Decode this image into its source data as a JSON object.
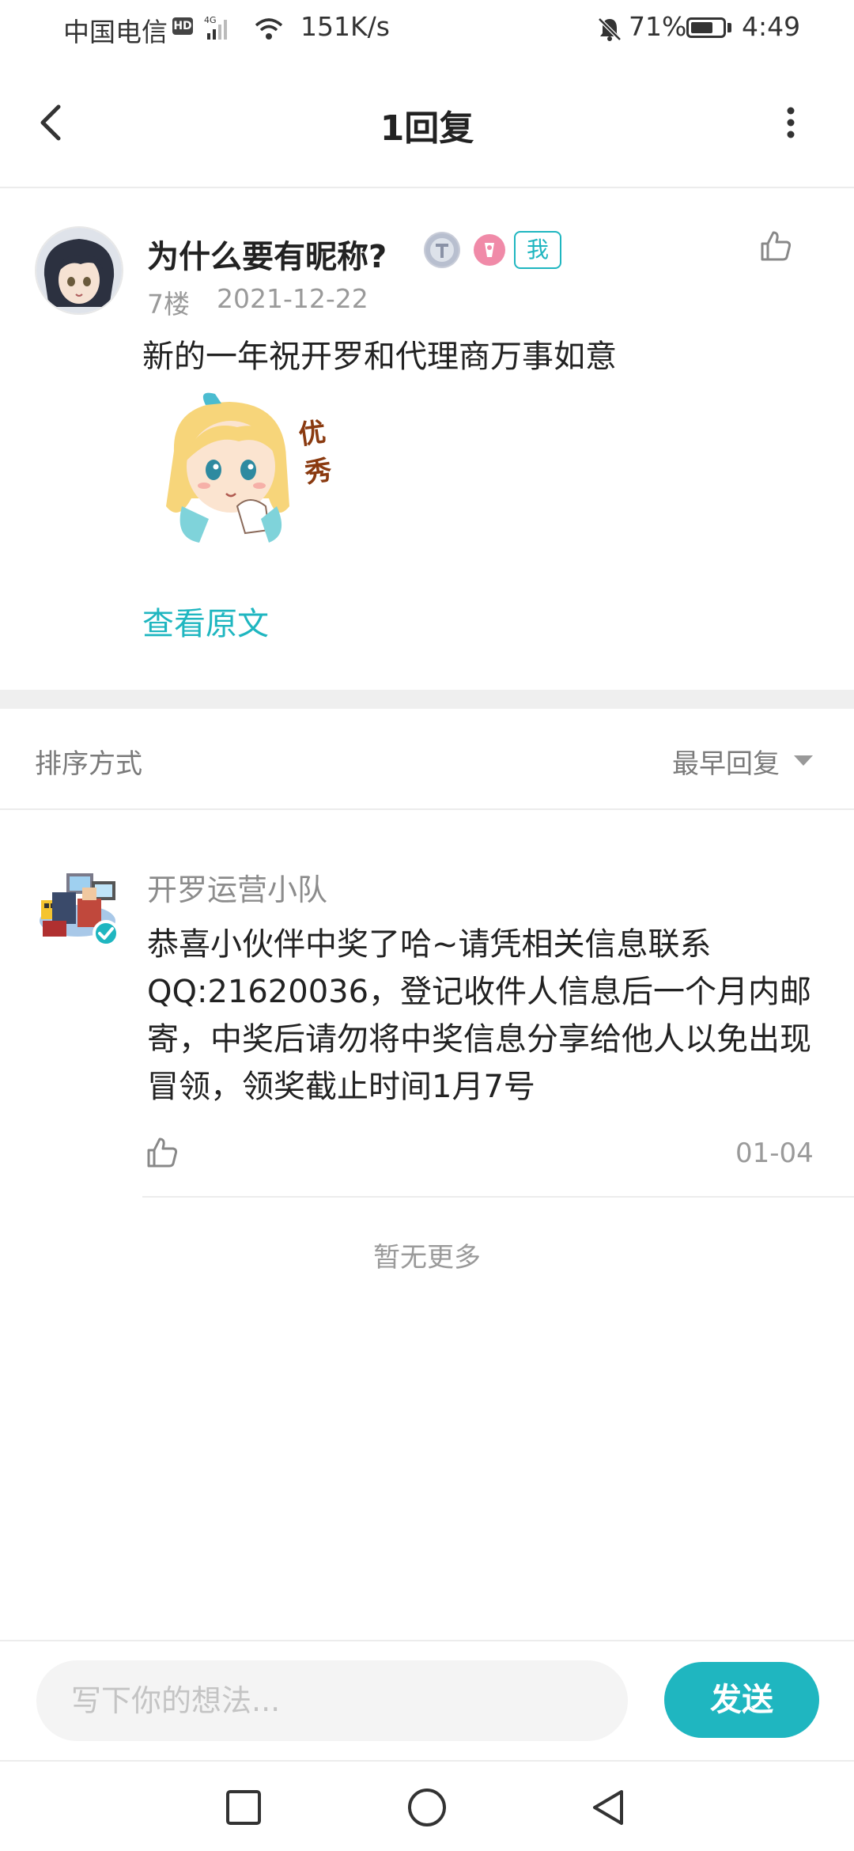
{
  "status_bar": {
    "carrier": "中国电信",
    "network_badge": "HD",
    "network_type": "4G",
    "speed": "151K/s",
    "battery": "71%",
    "battery_level": 0.71,
    "time": "4:49"
  },
  "header": {
    "title": "1回复"
  },
  "post": {
    "username": "为什么要有昵称?",
    "me_tag": "我",
    "floor": "7楼",
    "date": "2021-12-22",
    "content": "新的一年祝开罗和代理商万事如意",
    "sticker_text": "优秀",
    "view_original": "查看原文"
  },
  "sort": {
    "label": "排序方式",
    "value": "最早回复"
  },
  "replies": [
    {
      "author": "开罗运营小队",
      "content": "恭喜小伙伴中奖了哈~请凭相关信息联系QQ:21620036，登记收件人信息后一个月内邮寄，中奖后请勿将中奖信息分享给他人以免出现冒领，领奖截止时间1月7号",
      "date": "01-04"
    }
  ],
  "no_more": "暂无更多",
  "composer": {
    "placeholder": "写下你的想法...",
    "send_label": "发送"
  },
  "colors": {
    "accent": "#1fb6c0",
    "muted_text": "#9a9a9a",
    "divider": "#ececec"
  }
}
